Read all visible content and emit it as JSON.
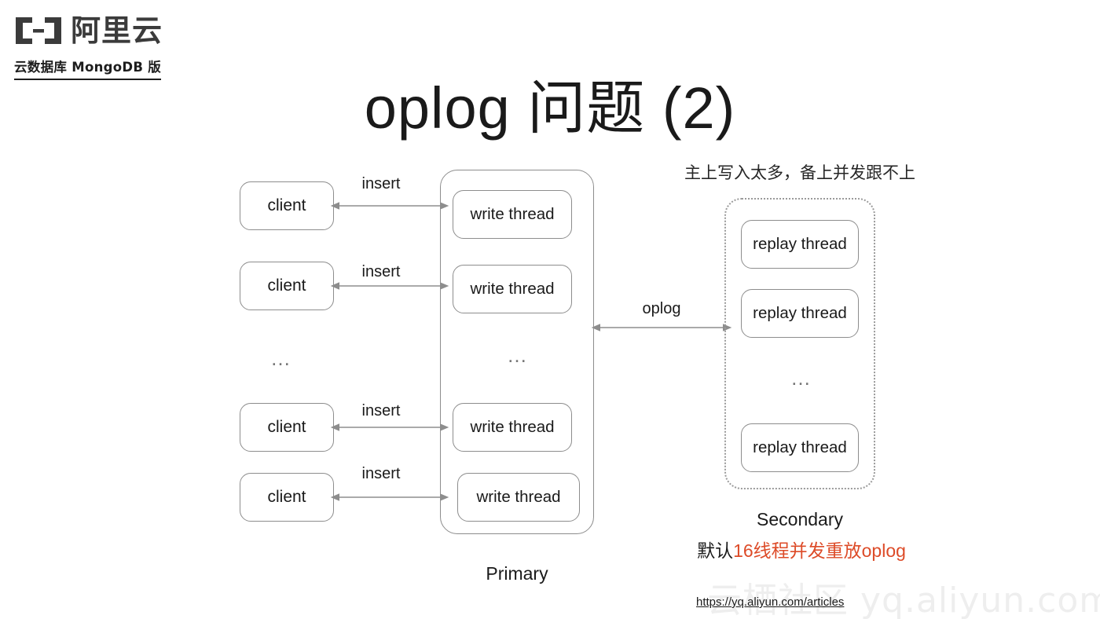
{
  "logo": {
    "mark_icon": "alibaba-cloud-bracket-icon",
    "wordmark": "阿里云",
    "subtitle": "云数据库 MongoDB 版"
  },
  "title": "oplog 问题 (2)",
  "diagram": {
    "clients": [
      {
        "label": "client"
      },
      {
        "label": "client"
      },
      {
        "label": "client"
      },
      {
        "label": "client"
      }
    ],
    "client_ellipsis": "…",
    "insert_labels": [
      "insert",
      "insert",
      "insert",
      "insert"
    ],
    "primary": {
      "caption": "Primary",
      "threads": [
        {
          "label": "write thread"
        },
        {
          "label": "write thread"
        },
        {
          "label": "write thread"
        },
        {
          "label": "write thread"
        }
      ],
      "ellipsis": "…"
    },
    "oplog_label": "oplog",
    "secondary": {
      "caption": "Secondary",
      "annotation_top": "主上写入太多，备上并发跟不上",
      "annotation_red_prefix": "默认",
      "annotation_red_highlight": "16线程并发重放oplog",
      "threads": [
        {
          "label": "replay thread"
        },
        {
          "label": "replay thread"
        },
        {
          "label": "replay thread"
        }
      ],
      "ellipsis": "…"
    }
  },
  "footer": {
    "link": "https://yq.aliyun.com/articles",
    "watermark": "云栖社区 yq.aliyun.com"
  },
  "colors": {
    "accent_red": "#dd4b28",
    "border_gray": "#8d8d8d",
    "text": "#1a1a1a",
    "watermark": "#eeeeee"
  }
}
